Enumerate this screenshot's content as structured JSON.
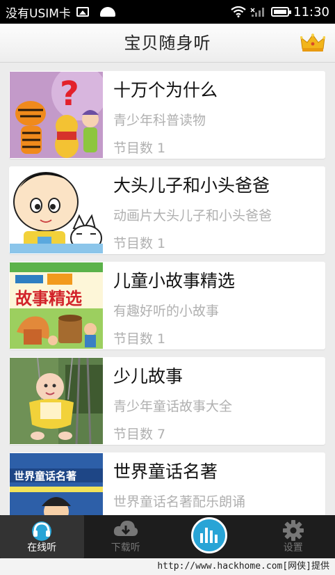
{
  "status_bar": {
    "carrier": "没有USIM卡",
    "time": "11:30"
  },
  "header": {
    "title": "宝贝随身听",
    "crown_icon": "crown-icon"
  },
  "list": {
    "items": [
      {
        "title": "十万个为什么",
        "subtitle": "青少年科普读物",
        "count": "节目数 1",
        "thumb": "cartoon-tigger-pooh"
      },
      {
        "title": "大头儿子和小头爸爸",
        "subtitle": "动画片大头儿子和小头爸爸",
        "count": "节目数 1",
        "thumb": "big-head-son-cartoon"
      },
      {
        "title": "儿童小故事精选",
        "subtitle": "有趣好听的小故事",
        "count": "节目数 1",
        "thumb": "story-book-cover"
      },
      {
        "title": "少儿故事",
        "subtitle": "青少年童话故事大全",
        "count": "节目数 7",
        "thumb": "baby-on-swing-photo"
      },
      {
        "title": "世界童话名著",
        "subtitle": "世界童话名著配乐朗诵",
        "count": "",
        "thumb": "fairy-tale-book-cover"
      }
    ]
  },
  "bottom_nav": {
    "tabs": [
      {
        "label": "在线听",
        "icon": "headphones-icon",
        "active": true
      },
      {
        "label": "下载听",
        "icon": "download-icon",
        "active": false
      },
      {
        "label": "",
        "icon": "audio-bars-icon",
        "active": false
      },
      {
        "label": "设置",
        "icon": "gear-icon",
        "active": false
      }
    ]
  },
  "watermark": "http://www.hackhome.com[网侠]提供",
  "colors": {
    "accent": "#28a4d6",
    "nav_background": "#1d1d1d",
    "page_background": "#ececec"
  }
}
